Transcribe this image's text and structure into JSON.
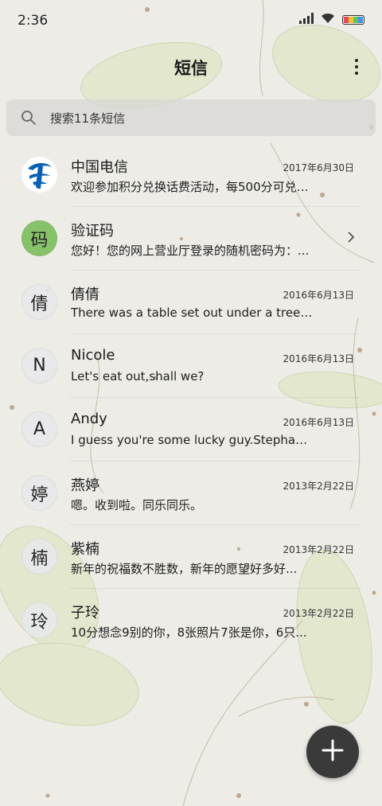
{
  "status_bar": {
    "time": "2:36",
    "battery_colors": [
      "#e84b5a",
      "#f3c13a",
      "#5fc456",
      "#4a8fe0"
    ]
  },
  "header": {
    "title": "短信"
  },
  "search": {
    "placeholder": "搜索11条短信"
  },
  "conversations": [
    {
      "avatar": "",
      "avatar_type": "logo",
      "name": "中国电信",
      "preview": "欢迎参加积分兑换话费活动，每500分可兑…",
      "date": "2017年6月30日"
    },
    {
      "avatar": "码",
      "avatar_type": "green",
      "name": "验证码",
      "preview": "您好！您的网上营业厅登录的随机密码为：...",
      "date": ""
    },
    {
      "avatar": "倩",
      "avatar_type": "plain",
      "name": "倩倩",
      "preview": "There was a table set out under a tree in...",
      "date": "2016年6月13日"
    },
    {
      "avatar": "N",
      "avatar_type": "plain",
      "name": "Nicole",
      "preview": "Let's eat out,shall we?",
      "date": "2016年6月13日"
    },
    {
      "avatar": "A",
      "avatar_type": "plain",
      "name": "Andy",
      "preview": "I guess you're some lucky guy.Stephani...",
      "date": "2016年6月13日"
    },
    {
      "avatar": "婷",
      "avatar_type": "plain",
      "name": "燕婷",
      "preview": "嗯。收到啦。同乐同乐。",
      "date": "2013年2月22日"
    },
    {
      "avatar": "楠",
      "avatar_type": "plain",
      "name": "紫楠",
      "preview": "新年的祝福数不胜数，新年的愿望好多好...",
      "date": "2013年2月22日"
    },
    {
      "avatar": "玲",
      "avatar_type": "plain",
      "name": "子玲",
      "preview": "10分想念9别的你，8张照片7张是你，6只...",
      "date": "2013年2月22日"
    }
  ],
  "icons": {
    "search": "search-icon",
    "more": "more-vertical-icon",
    "chevron": "chevron-right-icon",
    "compose": "plus-icon"
  }
}
